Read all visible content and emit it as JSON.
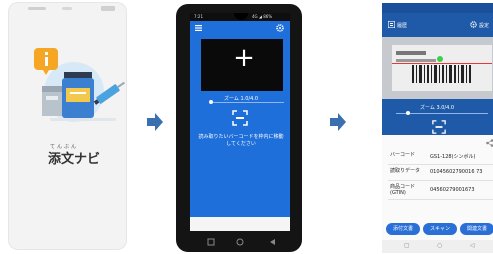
{
  "screen1": {
    "app_ruby": "てんぶん",
    "app_name": "添文ナビ"
  },
  "screen2": {
    "status_time": "7:21",
    "status_right": "4G ◢ 86%",
    "header_left_icon": "menu-icon",
    "header_right_icon": "gear-icon",
    "zoom_label": "ズーム 1.0/4.0",
    "message": "読み取りたいバーコードを枠内に移動してください"
  },
  "screen3": {
    "header_left_label": "履歴",
    "header_right_label": "設定",
    "zoom_label": "ズーム 3.0/4.0",
    "rows": [
      {
        "key": "バーコード",
        "value": "GS1-128(シンボル)"
      },
      {
        "key": "読取りデータ",
        "value": "01045602790016 73"
      },
      {
        "key": "商品コード\n(GTIN)",
        "value": "04560279001673"
      }
    ],
    "buttons": [
      "添付文書",
      "スキャン",
      "関連文書"
    ]
  },
  "colors": {
    "blue": "#1e6fd9",
    "darkblue": "#1e5aa8",
    "arrow": "#3a6fb0"
  }
}
